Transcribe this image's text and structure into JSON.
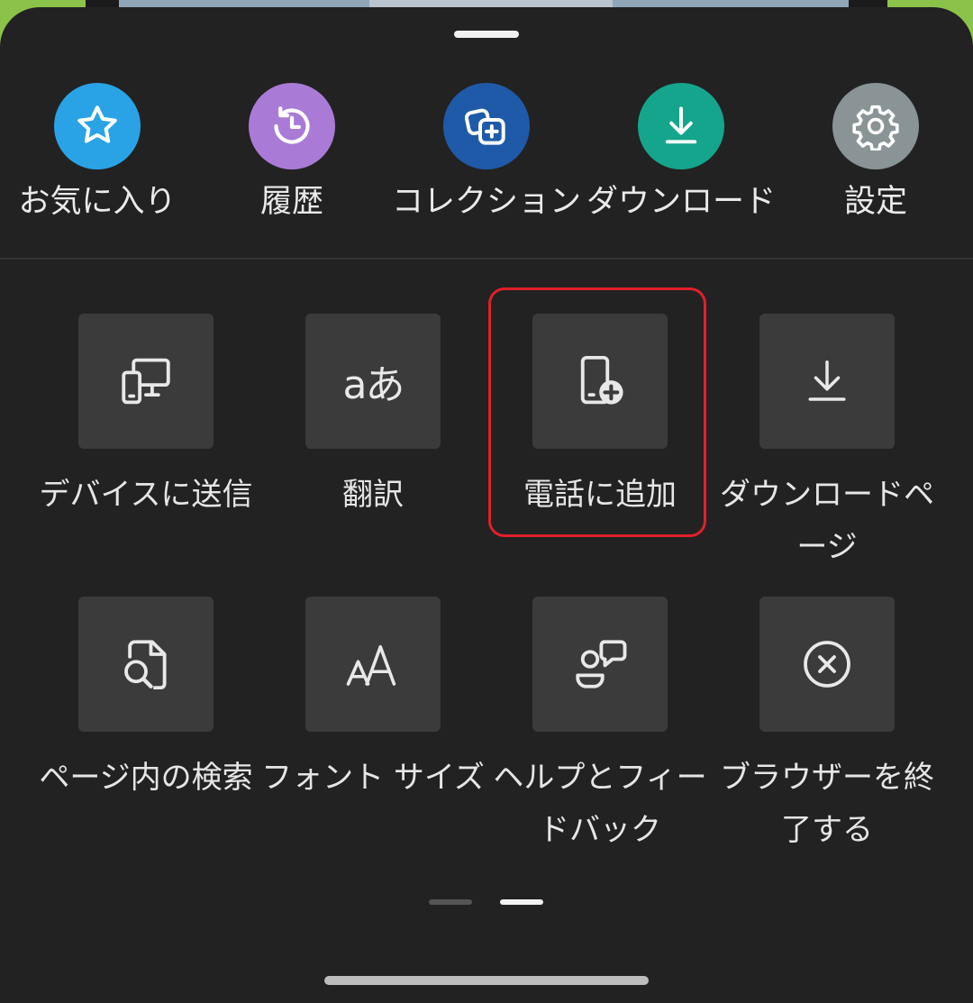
{
  "quick_actions": [
    {
      "label": "お気に入り",
      "icon": "star-icon",
      "color": "#29a3e6"
    },
    {
      "label": "履歴",
      "icon": "history-icon",
      "color": "#a97bd6"
    },
    {
      "label": "コレクション",
      "icon": "collections-icon",
      "color": "#1f5aa8"
    },
    {
      "label": "ダウンロード",
      "icon": "download-icon",
      "color": "#14a58c"
    },
    {
      "label": "設定",
      "icon": "gear-icon",
      "color": "#8a9396"
    }
  ],
  "menu_tiles": [
    {
      "label": "デバイスに送信",
      "icon": "send-to-device-icon"
    },
    {
      "label": "翻訳",
      "icon": "translate-icon"
    },
    {
      "label": "電話に追加",
      "icon": "add-to-phone-icon"
    },
    {
      "label": "ダウンロードページ",
      "icon": "download-page-icon"
    },
    {
      "label": "ページ内の検索",
      "icon": "find-in-page-icon"
    },
    {
      "label": "フォント サイズ",
      "icon": "font-size-icon"
    },
    {
      "label": "ヘルプとフィードバック",
      "icon": "help-feedback-icon"
    },
    {
      "label": "ブラウザーを終了する",
      "icon": "close-browser-icon"
    }
  ],
  "translate_glyph": "aあ",
  "font_glyph": "AA",
  "pagination": {
    "pages": 2,
    "current": 2
  },
  "highlight_color": "#e0202a"
}
